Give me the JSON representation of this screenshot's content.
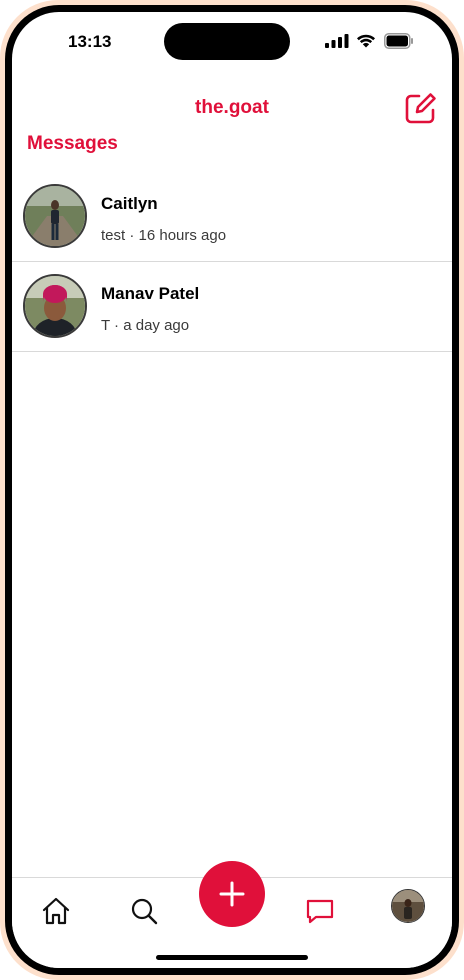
{
  "status_bar": {
    "time": "13:13",
    "icons": [
      "signal-icon",
      "wifi-icon",
      "battery-icon"
    ]
  },
  "header": {
    "title": "the.goat",
    "compose_icon": "compose-icon"
  },
  "section": {
    "title": "Messages"
  },
  "conversations": [
    {
      "name": "Caitlyn",
      "meta": "test · 16 hours ago"
    },
    {
      "name": "Manav Patel",
      "meta": "T · a day ago"
    }
  ],
  "tab_bar": {
    "icons": [
      "home-icon",
      "search-icon",
      "plus-icon",
      "chat-icon",
      "profile-avatar"
    ],
    "active": "chat-icon"
  },
  "colors": {
    "accent": "#e0103a",
    "frame": "#fde0cc"
  }
}
